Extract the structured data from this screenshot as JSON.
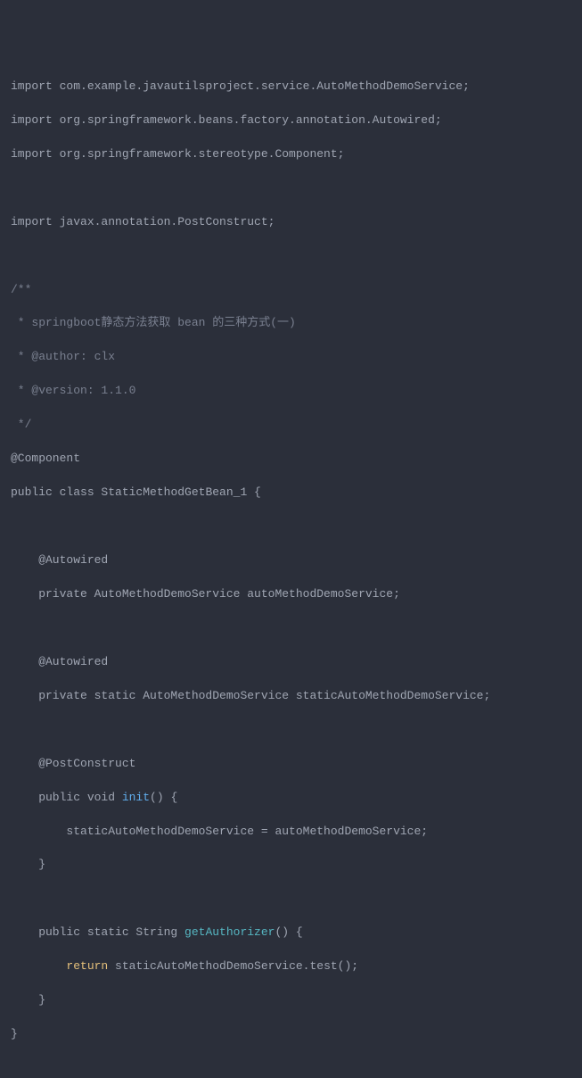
{
  "lines": {
    "l1_import": "import",
    "l1_pkg": " com.example.javautilsproject.service.AutoMethodDemoService;",
    "l2_import": "import",
    "l2_pkg": " org.springframework.beans.factory.annotation.Autowired;",
    "l3_import": "import",
    "l3_pkg": " org.springframework.stereotype.Component;",
    "l4_import": "import",
    "l4_pkg": " javax.annotation.PostConstruct;",
    "c1": "/**",
    "c2": " * springboot静态方法获取 bean 的三种方式(一)",
    "c3": " * @author: clx",
    "c4": " * @version: 1.1.0",
    "c5": " */",
    "ann_component": "@Component",
    "class_decl_a": "public class",
    "class_decl_b": " StaticMethodGetBean_1 {",
    "ann_autowired1": "    @Autowired",
    "field1": "    private AutoMethodDemoService autoMethodDemoService;",
    "ann_autowired2": "    @Autowired",
    "field2": "    private static AutoMethodDemoService staticAutoMethodDemoService;",
    "ann_postconstruct": "    @PostConstruct",
    "m1_a": "    public void ",
    "m1_name": "init",
    "m1_b": "() {",
    "m1_body": "        staticAutoMethodDemoService = autoMethodDemoService;",
    "m1_close": "    }",
    "m2_a": "    public static String ",
    "m2_name": "getAuthorizer",
    "m2_b": "() {",
    "m2_body_a": "        ",
    "m2_return": "return",
    "m2_body_b": " staticAutoMethodDemoService.test();",
    "m2_close": "    }",
    "class_close": "}"
  }
}
